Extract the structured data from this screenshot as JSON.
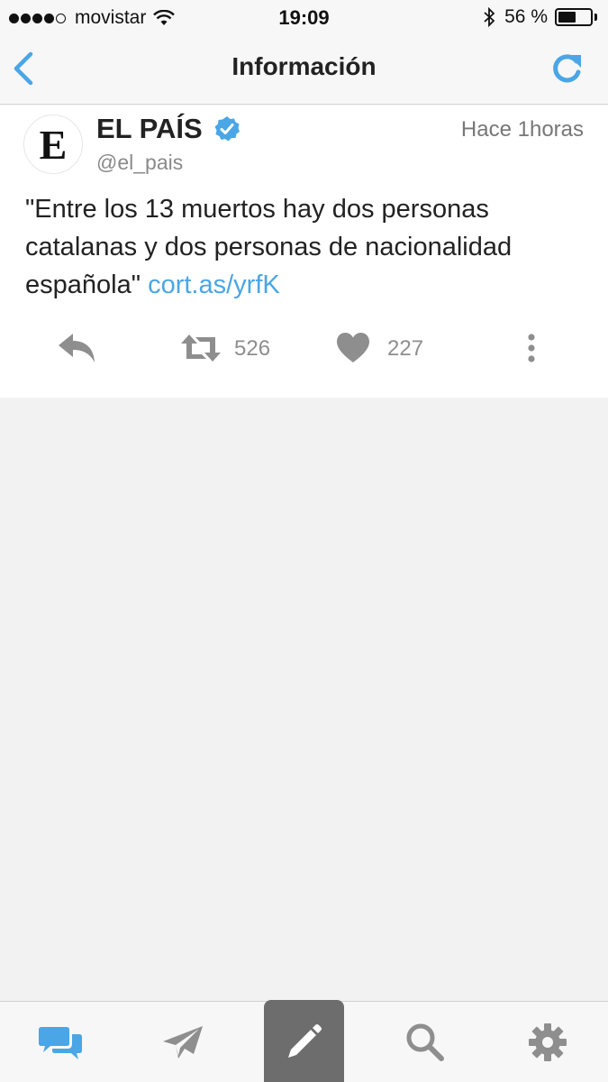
{
  "status_bar": {
    "carrier": "movistar",
    "time": "19:09",
    "battery": "56 %",
    "battery_level": 0.56
  },
  "nav": {
    "title": "Información",
    "back_icon": "chevron-left-icon",
    "refresh_icon": "refresh-icon"
  },
  "tweet": {
    "avatar_letter": "E",
    "author": "EL PAÍS",
    "handle": "@el_pais",
    "timestamp": "Hace 1horas",
    "text": "\"Entre los 13 muertos hay dos personas catalanas y dos personas de nacionalidad española\" ",
    "link": "cort.as/yrfK",
    "retweets": "526",
    "likes": "227"
  },
  "tabs": [
    {
      "name": "timeline",
      "icon": "chat-bubbles-icon",
      "active": true
    },
    {
      "name": "messages",
      "icon": "paper-plane-icon",
      "active": false
    },
    {
      "name": "compose",
      "icon": "pencil-icon",
      "active": false
    },
    {
      "name": "search",
      "icon": "search-icon",
      "active": false
    },
    {
      "name": "settings",
      "icon": "gear-icon",
      "active": false
    }
  ],
  "colors": {
    "accent": "#4aa6e6",
    "action_gray": "#8e8e8e",
    "compose_bg": "#6d6d6d"
  }
}
